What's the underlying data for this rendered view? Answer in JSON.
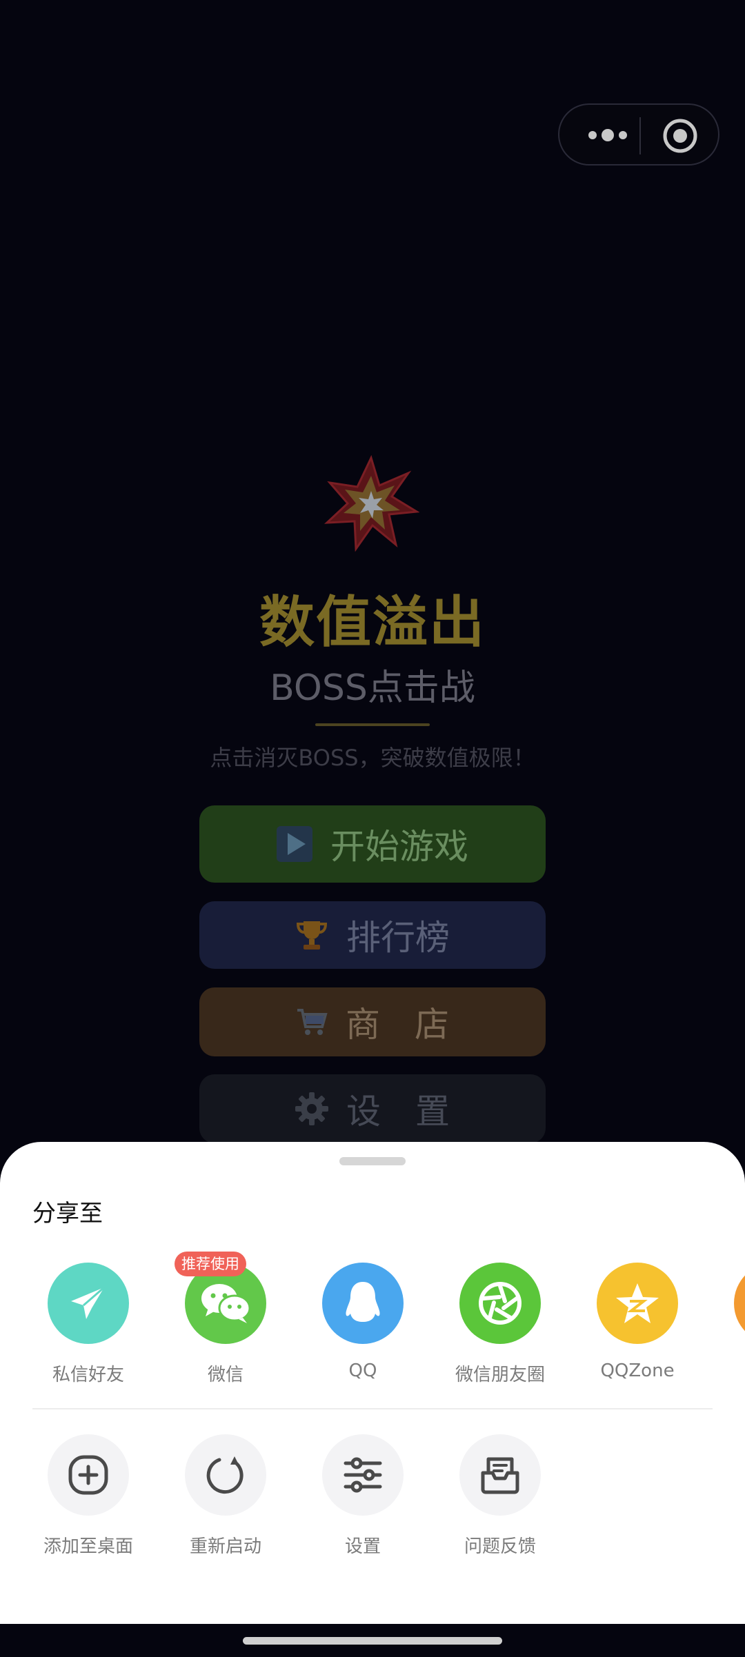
{
  "game": {
    "title": "数值溢出",
    "subtitle": "BOSS点击战",
    "tagline": "点击消灭BOSS，突破数值极限！",
    "buttons": {
      "start": "开始游戏",
      "rank": "排行榜",
      "shop": "商　店",
      "settings": "设　置"
    }
  },
  "share_sheet": {
    "title": "分享至",
    "share_row": [
      {
        "label": "私信好友",
        "icon": "paper-plane-icon",
        "color": "#5ed7c4"
      },
      {
        "label": "微信",
        "icon": "wechat-icon",
        "color": "#62c84a",
        "badge": "推荐使用"
      },
      {
        "label": "QQ",
        "icon": "qq-penguin-icon",
        "color": "#4aa7ee"
      },
      {
        "label": "微信朋友圈",
        "icon": "moments-shutter-icon",
        "color": "#5bc63a"
      },
      {
        "label": "QQZone",
        "icon": "qzone-star-icon",
        "color": "#f6c22f"
      }
    ],
    "action_row": [
      {
        "label": "添加至桌面",
        "icon": "add-icon"
      },
      {
        "label": "重新启动",
        "icon": "restart-icon"
      },
      {
        "label": "设置",
        "icon": "sliders-icon"
      },
      {
        "label": "问题反馈",
        "icon": "feedback-inbox-icon"
      }
    ]
  },
  "colors": {
    "background": "#05050f",
    "title_gold": "#7a6a24",
    "badge_red": "#f06258"
  }
}
